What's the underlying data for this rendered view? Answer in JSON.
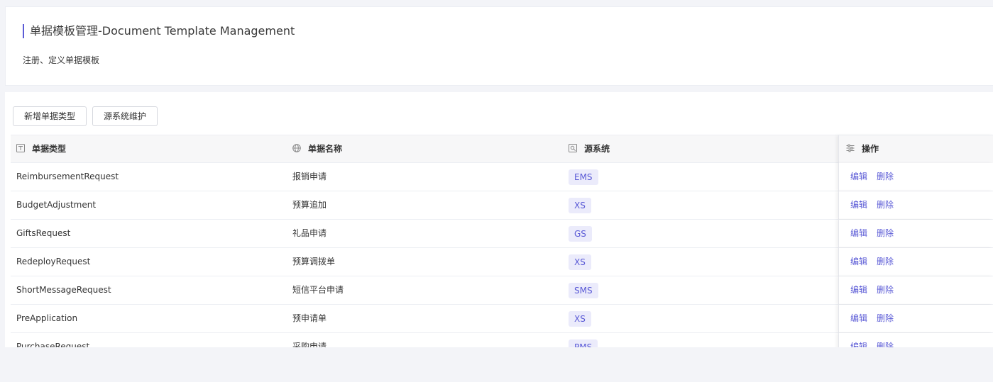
{
  "header": {
    "title": "单据模板管理-Document Template Management",
    "description": "注册、定义单据模板"
  },
  "toolbar": {
    "add_label": "新增单据类型",
    "maint_label": "源系统维护"
  },
  "table": {
    "columns": {
      "type": "单据类型",
      "name": "单据名称",
      "source": "源系统",
      "ops": "操作"
    },
    "edit_label": "编辑",
    "delete_label": "删除",
    "rows": [
      {
        "type": "ReimbursementRequest",
        "name": "报销申请",
        "source": "EMS"
      },
      {
        "type": "BudgetAdjustment",
        "name": "预算追加",
        "source": "XS"
      },
      {
        "type": "GiftsRequest",
        "name": "礼品申请",
        "source": "GS"
      },
      {
        "type": "RedeployRequest",
        "name": "预算调拨单",
        "source": "XS"
      },
      {
        "type": "ShortMessageRequest",
        "name": "短信平台申请",
        "source": "SMS"
      },
      {
        "type": "PreApplication",
        "name": "预申请单",
        "source": "XS"
      },
      {
        "type": "PurchaseRequest",
        "name": "采购申请",
        "source": "PMS"
      }
    ]
  },
  "colors": {
    "accent": "#5b5bd6",
    "tag_bg": "#ebebfb",
    "page_bg": "#f3f4f8"
  }
}
